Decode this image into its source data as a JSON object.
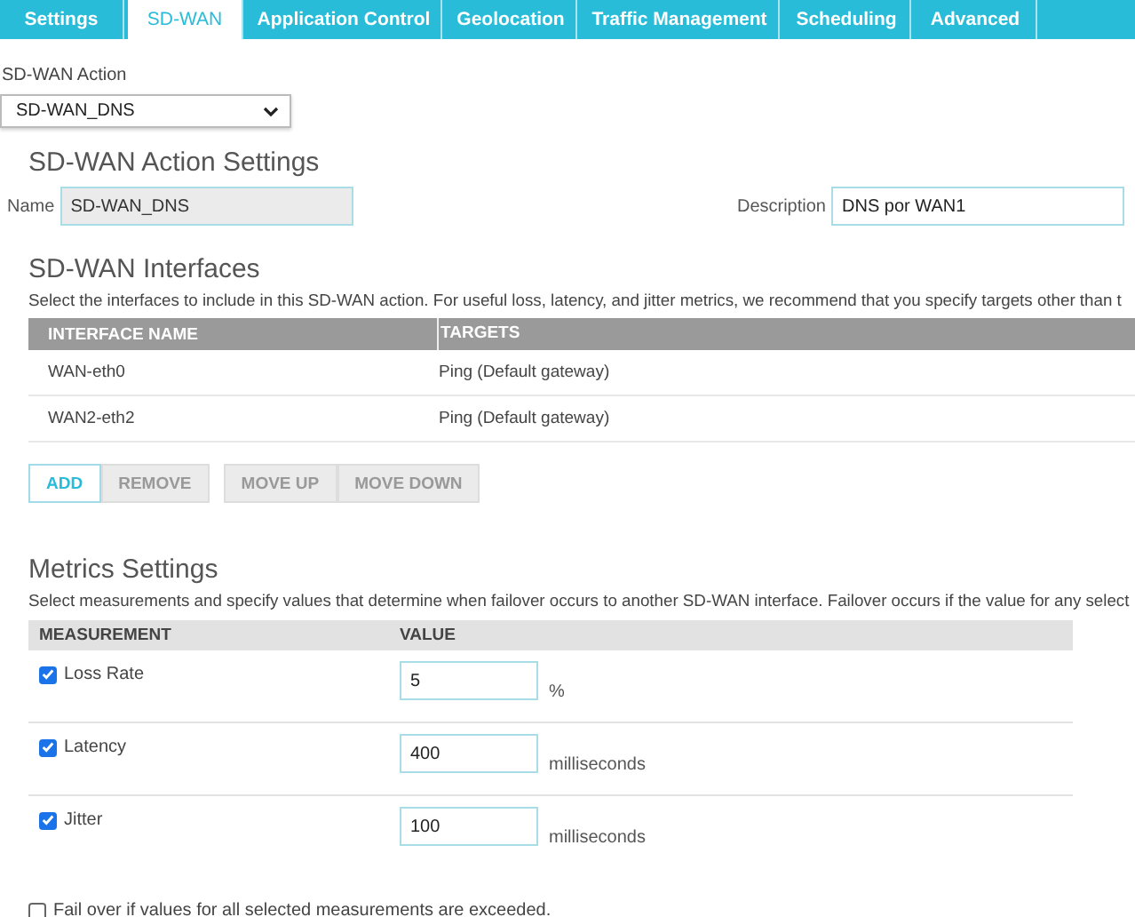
{
  "tabs": [
    {
      "label": "Settings",
      "selected": false
    },
    {
      "label": "SD-WAN",
      "selected": true
    },
    {
      "label": "Application Control",
      "selected": false
    },
    {
      "label": "Geolocation",
      "selected": false
    },
    {
      "label": "Traffic Management",
      "selected": false
    },
    {
      "label": "Scheduling",
      "selected": false
    },
    {
      "label": "Advanced",
      "selected": false
    }
  ],
  "action": {
    "label": "SD-WAN Action",
    "value": "SD-WAN_DNS"
  },
  "action_settings": {
    "title": "SD-WAN Action Settings",
    "name_label": "Name",
    "name_value": "SD-WAN_DNS",
    "description_label": "Description",
    "description_value": "DNS por WAN1"
  },
  "interfaces": {
    "title": "SD-WAN Interfaces",
    "description": "Select the interfaces to include in this SD-WAN action. For useful loss, latency, and jitter metrics, we recommend that you specify targets other than t",
    "columns": [
      "INTERFACE NAME",
      "TARGETS"
    ],
    "rows": [
      [
        "WAN-eth0",
        "Ping (Default gateway)"
      ],
      [
        "WAN2-eth2",
        "Ping (Default gateway)"
      ]
    ],
    "buttons": [
      {
        "label": "ADD",
        "disabled": false
      },
      {
        "label": "REMOVE",
        "disabled": true
      },
      {
        "label": "MOVE UP",
        "disabled": true
      },
      {
        "label": "MOVE DOWN",
        "disabled": true
      }
    ]
  },
  "metrics": {
    "title": "Metrics Settings",
    "description": "Select measurements and specify values that determine when failover occurs to another SD-WAN interface. Failover occurs if the value for any select",
    "columns": [
      "MEASUREMENT",
      "VALUE"
    ],
    "rows": [
      {
        "name": "Loss Rate",
        "checked": true,
        "value": "5",
        "unit": "%"
      },
      {
        "name": "Latency",
        "checked": true,
        "value": "400",
        "unit": "milliseconds"
      },
      {
        "name": "Jitter",
        "checked": true,
        "value": "100",
        "unit": "milliseconds"
      }
    ],
    "failover_all": {
      "label": "Fail over if values for all selected measurements are exceeded.",
      "checked": false
    }
  }
}
